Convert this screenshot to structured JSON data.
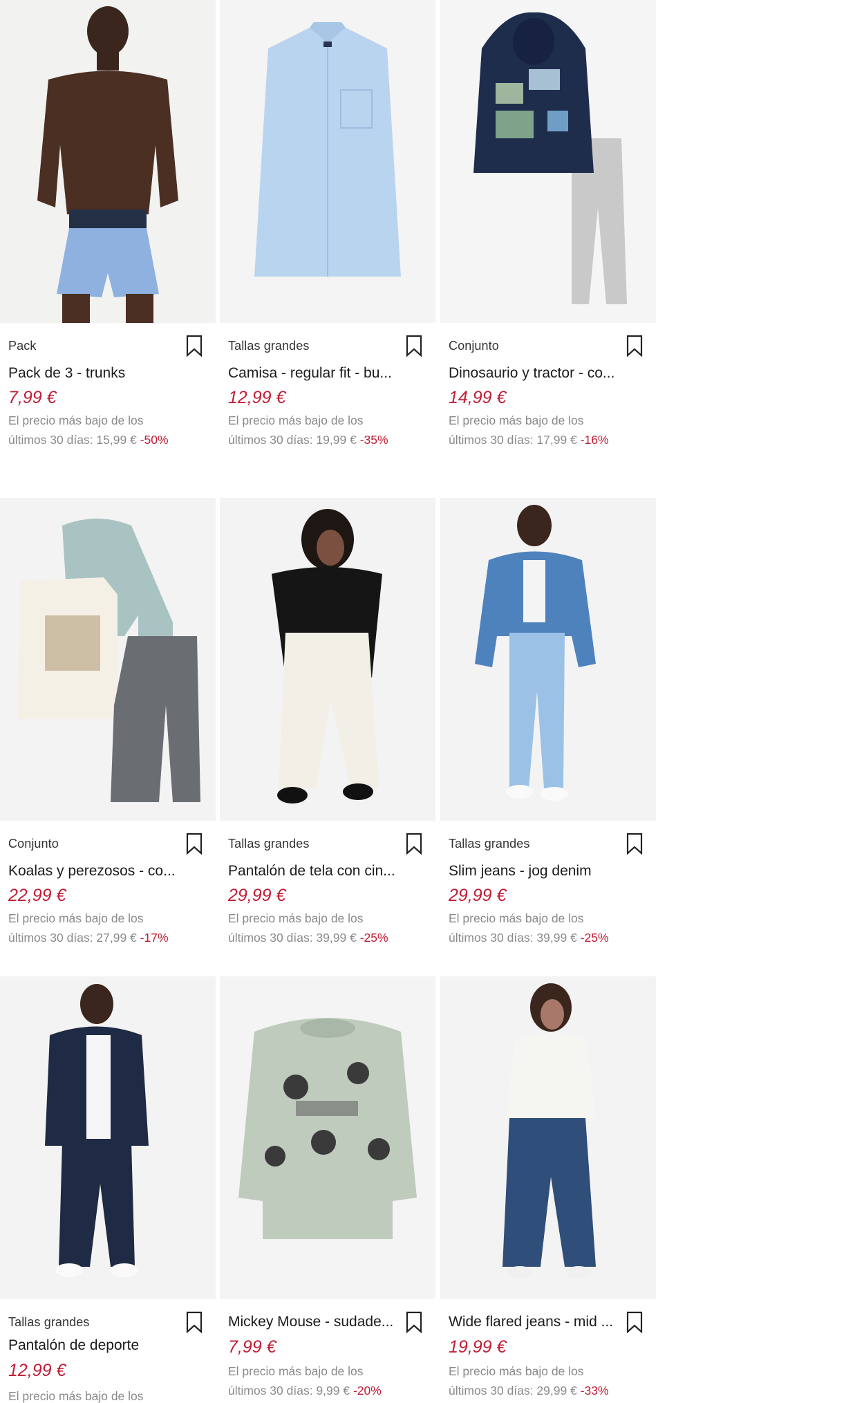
{
  "colors": {
    "price": "#c21d36",
    "muted": "#8a8a8a",
    "text": "#1b1b1b",
    "background": "#ffffff"
  },
  "products": [
    {
      "tag": "Pack",
      "name": "Pack de 3 - trunks",
      "price": "7,99 €",
      "low_line1": "El precio más bajo de los",
      "low_line2": "últimos 30 días: 15,99 €",
      "discount": "-50%",
      "image": "man-trunks-photo"
    },
    {
      "tag": "Tallas grandes",
      "name": "Camisa - regular fit - bu...",
      "price": "12,99 €",
      "low_line1": "El precio más bajo de los",
      "low_line2": "últimos 30 días: 19,99 €",
      "discount": "-35%",
      "image": "light-blue-shirt-photo"
    },
    {
      "tag": "Conjunto",
      "name": "Dinosaurio y tractor - co...",
      "price": "14,99 €",
      "low_line1": "El precio más bajo de los",
      "low_line2": "últimos 30 días: 17,99 €",
      "discount": "-16%",
      "image": "kids-hoodie-set-photo"
    },
    {
      "tag": "Conjunto",
      "name": "Koalas y perezosos - co...",
      "price": "22,99 €",
      "low_line1": "El precio más bajo de los",
      "low_line2": "últimos 30 días: 27,99 €",
      "discount": "-17%",
      "image": "kids-koala-set-photo"
    },
    {
      "tag": "Tallas grandes",
      "name": "Pantalón de tela con cin...",
      "price": "29,99 €",
      "low_line1": "El precio más bajo de los",
      "low_line2": "últimos 30 días: 39,99 €",
      "discount": "-25%",
      "image": "woman-white-trousers-photo"
    },
    {
      "tag": "Tallas grandes",
      "name": "Slim jeans - jog denim",
      "price": "29,99 €",
      "low_line1": "El precio más bajo de los",
      "low_line2": "últimos 30 días: 39,99 €",
      "discount": "-25%",
      "image": "man-denim-outfit-photo"
    },
    {
      "tag": "Tallas grandes",
      "name": "Pantalón de deporte",
      "price": "12,99 €",
      "low_line1": "El precio más bajo de los",
      "low_line2": "",
      "discount": "",
      "image": "man-tracksuit-photo"
    },
    {
      "tag": "",
      "name": "Mickey Mouse - sudade...",
      "price": "7,99 €",
      "low_line1": "El precio más bajo de los",
      "low_line2": "últimos 30 días: 9,99 €",
      "discount": "-20%",
      "image": "mickey-sweatshirt-photo"
    },
    {
      "tag": "",
      "name": "Wide flared jeans - mid ...",
      "price": "19,99 €",
      "low_line1": "El precio más bajo de los",
      "low_line2": "últimos 30 días: 29,99 €",
      "discount": "-33%",
      "image": "woman-flared-jeans-photo"
    }
  ]
}
